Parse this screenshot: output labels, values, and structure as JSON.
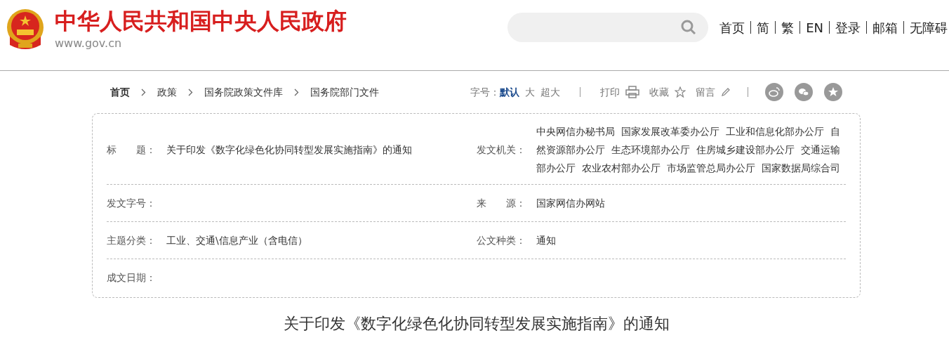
{
  "header": {
    "site_title": "中华人民共和国中央人民政府",
    "site_url": "www.gov.cn",
    "nav_links": [
      "首页",
      "简",
      "繁",
      "EN",
      "登录",
      "邮箱",
      "无障碍"
    ]
  },
  "breadcrumb": [
    "首页",
    "政策",
    "国务院政策文件库",
    "国务院部门文件"
  ],
  "tools": {
    "font_size_label": "字号：",
    "font_sizes": [
      {
        "label": "默认",
        "selected": true
      },
      {
        "label": "大",
        "selected": false
      },
      {
        "label": "超大",
        "selected": false
      }
    ],
    "print": "打印",
    "favorite": "收藏",
    "comment": "留言"
  },
  "info_table": {
    "rows": [
      [
        {
          "label": "标　　题：",
          "value": "关于印发《数字化绿色化协同转型发展实施指南》的通知"
        },
        {
          "label": "发文机关：",
          "value": "中央网信办秘书局  国家发展改革委办公厅  工业和信息化部办公厅  自然资源部办公厅  生态环境部办公厅  住房城乡建设部办公厅  交通运输部办公厅  农业农村部办公厅  市场监管总局办公厅  国家数据局综合司"
        }
      ],
      [
        {
          "label": "发文字号："
        },
        {
          "label": "来　　源：",
          "value": "国家网信办网站"
        }
      ],
      [
        {
          "label": "主题分类：",
          "value": "工业、交通\\信息产业（含电信）"
        },
        {
          "label": "公文种类：",
          "value": "通知"
        }
      ],
      [
        {
          "label": "成文日期："
        }
      ]
    ]
  },
  "article_title": "关于印发《数字化绿色化协同转型发展实施指南》的通知"
}
